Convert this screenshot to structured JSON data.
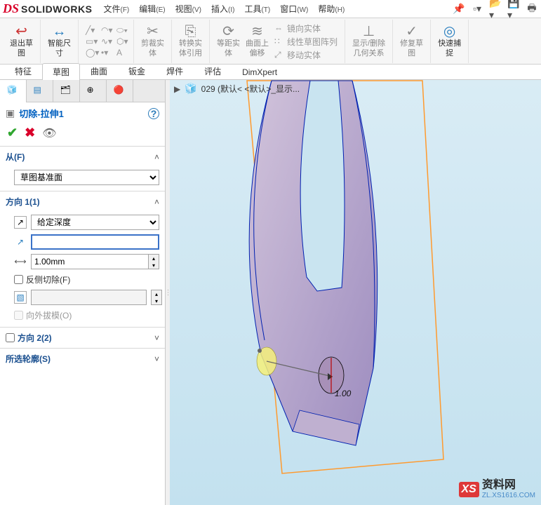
{
  "app": {
    "logo_text": "SOLIDWORKS"
  },
  "menu": {
    "items": [
      {
        "label": "文件",
        "accel": "(F)"
      },
      {
        "label": "编辑",
        "accel": "(E)"
      },
      {
        "label": "视图",
        "accel": "(V)"
      },
      {
        "label": "插入",
        "accel": "(I)"
      },
      {
        "label": "工具",
        "accel": "(T)"
      },
      {
        "label": "窗口",
        "accel": "(W)"
      },
      {
        "label": "帮助",
        "accel": "(H)"
      }
    ]
  },
  "ribbon": {
    "exit_sketch": "退出草\n图",
    "smart_dim": "智能尺\n寸",
    "trim": "剪裁实\n体",
    "convert": "转换实\n体引用",
    "offset": "等距实\n体",
    "offset_surf": "曲面上\n偏移",
    "mirror": "镜向实体",
    "linear_pattern": "线性草图阵列",
    "move": "移动实体",
    "display_delete": "显示/删除\n几何关系",
    "repair": "修复草\n图",
    "quick_snap": "快速捕\n捉"
  },
  "cmd_tabs": [
    "特征",
    "草图",
    "曲面",
    "钣金",
    "焊件",
    "评估",
    "DimXpert"
  ],
  "gfx": {
    "breadcrumb": "029  (默认< <默认>_显示..."
  },
  "pm": {
    "title": "切除-拉伸1",
    "from_label": "从(F)",
    "from_value": "草图基准面",
    "dir1_label": "方向 1(1)",
    "dir1_type": "给定深度",
    "dir1_depth": "1.00mm",
    "flip_cut": "反侧切除(F)",
    "draft_out": "向外拔模(O)",
    "dir2_label": "方向 2(2)",
    "contours_label": "所选轮廓(S)"
  },
  "watermark": {
    "badge": "XS",
    "title": "资料网",
    "url": "ZL.XS1616.COM"
  }
}
